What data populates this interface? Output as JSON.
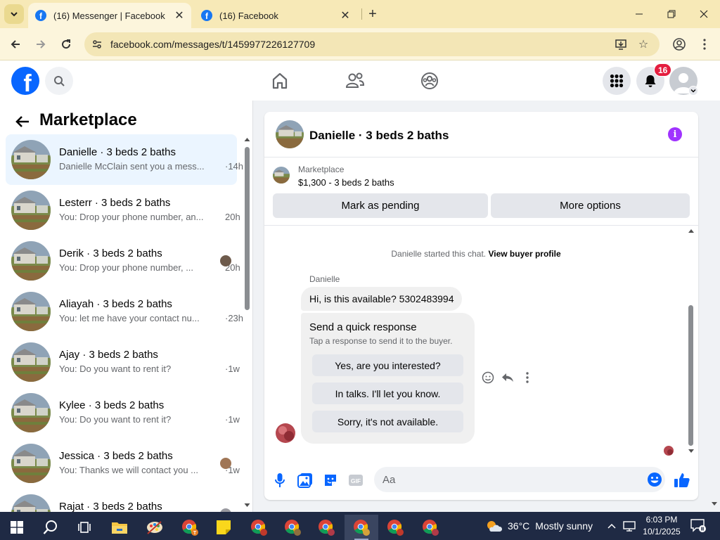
{
  "browser": {
    "tabs": [
      {
        "title": "(16) Messenger | Facebook",
        "active": true
      },
      {
        "title": "(16) Facebook",
        "active": false
      }
    ],
    "url": "facebook.com/messages/t/1459977226127709"
  },
  "fb_header": {
    "logo_letter": "f",
    "notification_count": "16"
  },
  "left_pane": {
    "title": "Marketplace",
    "conversations": [
      {
        "name": "Danielle · 3 beds 2 baths",
        "preview": "Danielle McClain sent you a mess...",
        "time": "·14h",
        "selected": true
      },
      {
        "name": "Lesterr · 3 beds 2 baths",
        "preview": "You: Drop your phone number, an...",
        "time": "20h"
      },
      {
        "name": "Derik · 3 beds 2 baths",
        "preview": "You: Drop your phone number, ...",
        "time": "20h"
      },
      {
        "name": "Aliayah · 3 beds 2 baths",
        "preview": "You: let me have your contact nu...",
        "time": "·23h"
      },
      {
        "name": "Ajay · 3 beds 2 baths",
        "preview": "You: Do you want to rent it?",
        "time": "·1w"
      },
      {
        "name": "Kylee · 3 beds 2 baths",
        "preview": "You: Do you want to rent it?",
        "time": "·1w"
      },
      {
        "name": "Jessica · 3 beds 2 baths",
        "preview": "You: Thanks we will contact you ...",
        "time": "·1w"
      },
      {
        "name": "Rajat · 3 beds 2 baths",
        "preview": "",
        "time": ""
      }
    ]
  },
  "chat": {
    "title": "Danielle · 3 beds 2 baths",
    "marketplace_label": "Marketplace",
    "listing": "$1,300 - 3 beds 2 baths",
    "buttons": {
      "pending": "Mark as pending",
      "more": "More options"
    },
    "system_text": "Danielle started this chat.",
    "system_link": "View buyer profile",
    "sender": "Danielle",
    "message": "Hi, is this available? 5302483994",
    "quick_response": {
      "title": "Send a quick response",
      "subtitle": "Tap a response to send it to the buyer.",
      "options": [
        "Yes, are you interested?",
        "In talks. I'll let you know.",
        "Sorry, it's not available."
      ]
    },
    "composer_placeholder": "Aa"
  },
  "taskbar": {
    "weather_temp": "36°C",
    "weather_condition": "Mostly sunny",
    "time": "6:03 PM",
    "date": "10/1/2025"
  },
  "colors": {
    "facebook_blue": "#0866ff",
    "messenger_purple": "#a033ff",
    "badge_red": "#e41e3f",
    "selected_row": "#ebf5ff",
    "browser_frame": "#f7e9b7"
  }
}
